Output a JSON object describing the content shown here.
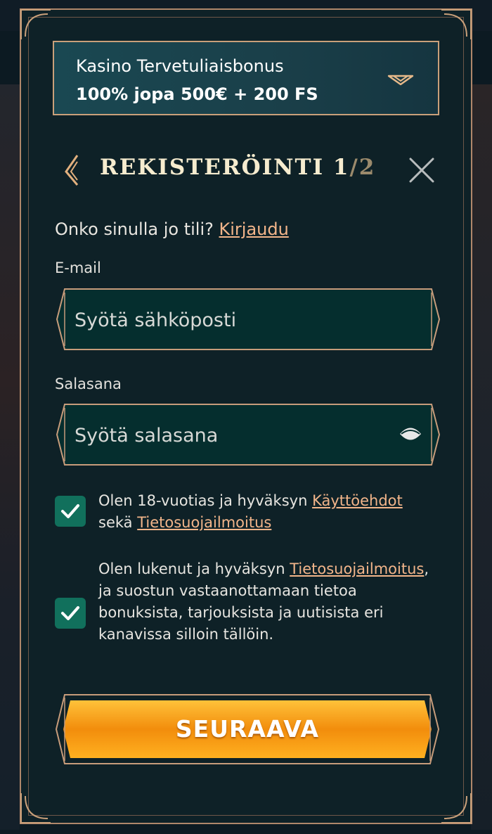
{
  "bonus": {
    "title": "Kasino Tervetuliaisbonus",
    "value": "100% jopa 500€ + 200 FS",
    "chevron_icon": "chevron-down-icon"
  },
  "header": {
    "step_label": "REKISTERÖINTI 1",
    "step_total": "/2",
    "back_icon": "chevron-left-icon",
    "close_icon": "close-icon"
  },
  "login": {
    "prompt": "Onko sinulla jo tili?",
    "link_label": "Kirjaudu"
  },
  "email": {
    "label": "E-mail",
    "placeholder": "Syötä sähköposti",
    "value": ""
  },
  "password": {
    "label": "Salasana",
    "placeholder": "Syötä salasana",
    "value": "",
    "toggle_icon": "eye-icon"
  },
  "consents": [
    {
      "checked": true,
      "text_before": "Olen 18-vuotias ja hyväksyn ",
      "link1": "Käyttöehdot",
      "text_middle": "sekä ",
      "link2": "Tietosuojailmoitus"
    },
    {
      "checked": true,
      "text_before": "Olen lukenut ja hyväksyn ",
      "link1": "Tietosuojailmoitus",
      "text_after": ", ja suostun vastaanottamaan tietoa bonuksista, tarjouksista ja uutisista eri kanavissa silloin tällöin."
    }
  ],
  "next_button": {
    "label": "SEURAAVA"
  },
  "colors": {
    "panel_bg": "#0e2127",
    "gold_border": "#b0876b",
    "link": "#f2b58a",
    "checkbox": "#11705c",
    "button_orange": "#f49a12"
  }
}
